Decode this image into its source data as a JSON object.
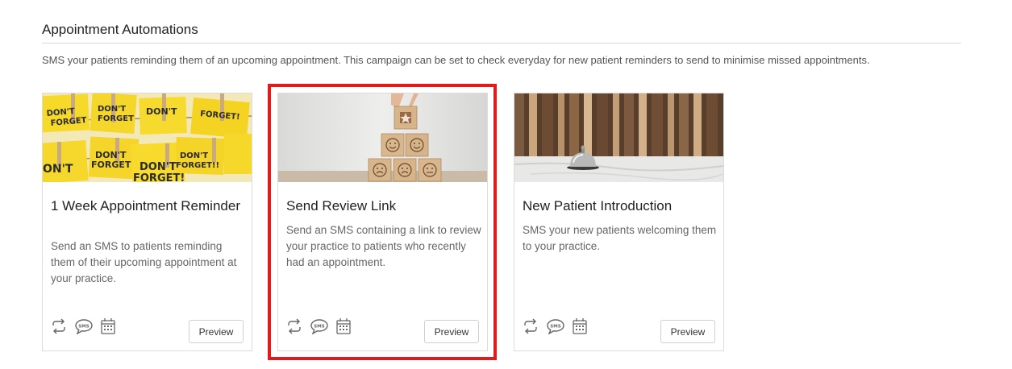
{
  "section": {
    "title": "Appointment Automations",
    "description": "SMS your patients reminding them of an upcoming appointment. This campaign can be set to check everyday for new patient reminders to send to minimise missed appointments."
  },
  "cards": [
    {
      "title": "1 Week Appointment Reminder",
      "description": "Send an SMS to patients reminding them of their upcoming appointment at your practice.",
      "preview_label": "Preview",
      "image_text": [
        "DON'T FORGET",
        "DON'T FORGET",
        "DON'T FORGET",
        "DON'T FORGET!",
        "DON'T FORGET",
        "DON'T",
        "DON'T FORGET!!"
      ],
      "icons": [
        "repeat-icon",
        "sms-icon",
        "calendar-icon"
      ]
    },
    {
      "title": "Send Review Link",
      "description": "Send an SMS containing a link to review your practice to patients who recently had an appointment.",
      "preview_label": "Preview",
      "icons": [
        "repeat-icon",
        "sms-icon",
        "calendar-icon"
      ]
    },
    {
      "title": "New Patient Introduction",
      "description": "SMS your new patients welcoming them to your practice.",
      "preview_label": "Preview",
      "icons": [
        "repeat-icon",
        "sms-icon",
        "calendar-icon"
      ]
    }
  ],
  "colors": {
    "highlight": "#e01b1b",
    "sticky_note": "#f5d62a",
    "icon": "#666666"
  }
}
